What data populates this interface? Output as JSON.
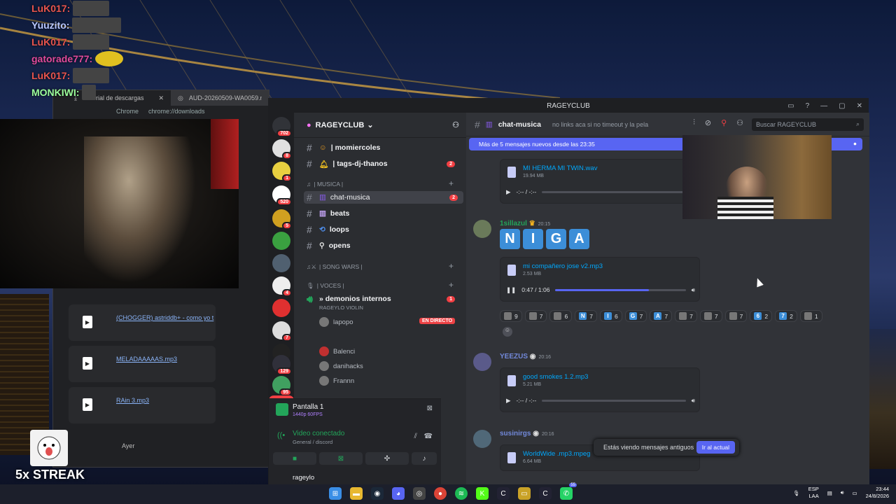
{
  "stream_chat": [
    {
      "user": "LuK017:",
      "color": "#e8544d"
    },
    {
      "user": "Yuuzito:",
      "color": "#b9c8ff"
    },
    {
      "user": "LuK017:",
      "color": "#e8544d"
    },
    {
      "user": "gatorade777:",
      "color": "#e04a9c"
    },
    {
      "user": "LuK017:",
      "color": "#e8544d"
    },
    {
      "user": "MONKIWI:",
      "color": "#9cff9c"
    }
  ],
  "streak": "5x STREAK",
  "chrome": {
    "tab1": "historial de descargas",
    "tab2": "AUD-20260509-WA0059.mp3",
    "scheme": "Chrome",
    "url": "chrome://downloads",
    "downloads": [
      "(CHOGGER) astriddb+ - como yo t",
      "MELADAAAAAS.mp3",
      "RAin 3.mp3"
    ],
    "day_label": "Ayer"
  },
  "discord": {
    "window_title": "RAGEYCLUB",
    "server_name": "RAGEYCLUB",
    "guild_badges": [
      "702",
      "8",
      "1",
      "520",
      "5",
      "",
      "",
      "4",
      "",
      "7",
      "",
      "129",
      "95"
    ],
    "new_label": "NUEVO",
    "channels": [
      {
        "name": "| momiercoles",
        "badge": ""
      },
      {
        "name": "| tags-dj-thanos",
        "badge": "2"
      }
    ],
    "cat_musica": "| MUSICA |",
    "music_channels": [
      {
        "name": "chat-musica",
        "badge": "2"
      },
      {
        "name": "beats",
        "badge": ""
      },
      {
        "name": "loops",
        "badge": ""
      },
      {
        "name": "opens",
        "badge": ""
      }
    ],
    "cat_songwars": "| SONG WARS |",
    "cat_voces": "| VOCES |",
    "voice_channel": "» demonios internos",
    "voice_badge": "1",
    "voice_sub": "RAGEYLO VIOLIN",
    "voice_users": [
      "lapopo",
      "Balenci",
      "danihacks",
      "Frannn"
    ],
    "live_label": "EN DIRECTO",
    "screen_title": "Pantalla 1",
    "screen_sub": "1440p 60FPS",
    "video_connected": "Video conectado",
    "video_sub": "General / discord",
    "username": "rageylo",
    "current_channel": "chat-musica",
    "topic": "no links aca si no timeout y la pela",
    "search_placeholder": "Buscar RAGEYCLUB",
    "new_messages_bar": "Más de 5 mensajes nuevos desde las 23:35",
    "old_notice": "Estás viendo mensajes antiguos",
    "go_current": "Ir al actual",
    "messages": [
      {
        "author": "",
        "time": "",
        "file": "MI HERMA MI TWIN.wav",
        "size": "19.94 MB",
        "player": "-:-- / -:--",
        "progress": 0
      },
      {
        "author": "1sillazul",
        "time": "20:15",
        "letters": [
          "N",
          "I",
          "G",
          "A"
        ],
        "file": "mi compañero jose v2.mp3",
        "size": "2.53 MB",
        "player": "0:47 / 1:06",
        "progress": 0.72
      },
      {
        "author": "YEEZUS",
        "time": "20:16",
        "file": "good smokes 1.2.mp3",
        "size": "5.21 MB",
        "player": "-:-- / -:--",
        "progress": 0
      },
      {
        "author": "susinirgs",
        "time": "20:16",
        "file": "WorldWide .mp3.mpeg",
        "size": "6.64 MB",
        "player": "",
        "progress": 0
      }
    ],
    "reactions": [
      {
        "count": "9"
      },
      {
        "count": "7"
      },
      {
        "count": "6"
      },
      {
        "count": "7",
        "letter": "N"
      },
      {
        "count": "6",
        "letter": "I"
      },
      {
        "count": "7",
        "letter": "G"
      },
      {
        "count": "7",
        "letter": "A"
      },
      {
        "count": "7"
      },
      {
        "count": "7"
      },
      {
        "count": "7"
      },
      {
        "count": "2",
        "letter": "6"
      },
      {
        "count": "2",
        "letter": "7"
      },
      {
        "count": "1"
      }
    ]
  },
  "taskbar": {
    "lang": "ESP",
    "lang2": "LAA",
    "time": "23:44",
    "date": "24/8/2026",
    "whatsapp_badge": "55"
  },
  "colors": {
    "blurple": "#5865f2",
    "green": "#23a55a",
    "red": "#f23f43"
  }
}
